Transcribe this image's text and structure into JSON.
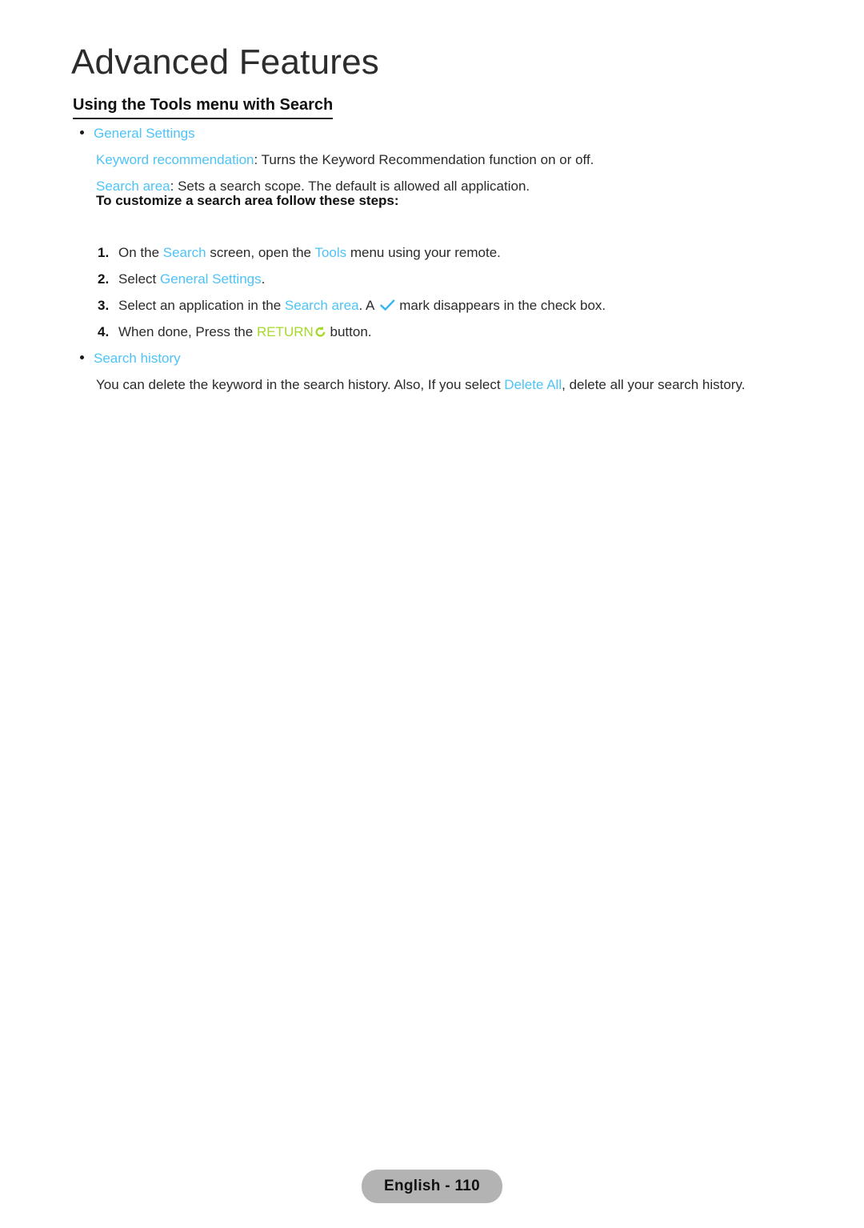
{
  "document": {
    "chapter_title": "Advanced Features",
    "section_heading": "Using the Tools menu with Search"
  },
  "colors": {
    "accent_cyan": "#4ec3f7",
    "accent_green": "#a5da2a",
    "body_text": "#2a2a2a",
    "badge_background": "#b3b3b3"
  },
  "content": {
    "general_settings": {
      "bullet_label": "General Settings",
      "keyword_recommendation": {
        "term": "Keyword recommendation",
        "description": ": Turns the Keyword Recommendation function on or off."
      },
      "search_area": {
        "term": "Search area",
        "description": ": Sets a search scope. The default is allowed all application."
      },
      "steps_intro": "To customize a search area follow these steps:",
      "steps": [
        {
          "number": "1.",
          "pre": "On the ",
          "term1": "Search",
          "mid": " screen, open the ",
          "term2": "Tools",
          "post": " menu using your remote."
        },
        {
          "number": "2.",
          "pre": "Select ",
          "term1": "General Settings",
          "post": "."
        },
        {
          "number": "3.",
          "pre": "Select an application in the ",
          "term1": "Search area",
          "mid": ". A ",
          "icon": "check-mark-icon",
          "post": "mark disappears in the check box."
        },
        {
          "number": "4.",
          "pre": "When done, Press the ",
          "term1": "RETURN",
          "icon": "return-arrow-icon",
          "post": " button."
        }
      ]
    },
    "search_history": {
      "bullet_label": "Search history",
      "paragraph_pre": "You can delete the keyword in the search history. Also, If you select ",
      "paragraph_term": "Delete All",
      "paragraph_post": ", delete all your search history."
    }
  },
  "footer": {
    "page_label": "English - 110"
  }
}
